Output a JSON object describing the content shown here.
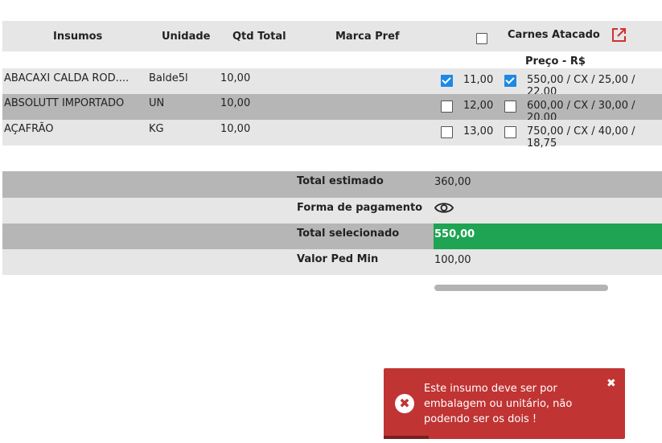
{
  "header": {
    "col_insumos": "Insumos",
    "col_unidade": "Unidade",
    "col_qtd_total": "Qtd Total",
    "col_marca_pref": "Marca Pref",
    "supplier_name": "Carnes Atacado",
    "price_label": "Preço - R$",
    "external_link_icon": "external-link-icon"
  },
  "rows": [
    {
      "insumo": "ABACAXI CALDA ROD....",
      "unidade": "Balde5l",
      "qtd": "10,00",
      "marca": "",
      "checked_qty": true,
      "qty_value": "11,00",
      "checked_price": true,
      "price_text": "550,00 / CX / 25,00 / 22,00"
    },
    {
      "insumo": "ABSOLUTT IMPORTADO",
      "unidade": "UN",
      "qtd": "10,00",
      "marca": "",
      "checked_qty": false,
      "qty_value": "12,00",
      "checked_price": false,
      "price_text": "600,00 / CX / 30,00 / 20,00"
    },
    {
      "insumo": "AÇAFRÃO",
      "unidade": "KG",
      "qtd": "10,00",
      "marca": "",
      "checked_qty": false,
      "qty_value": "13,00",
      "checked_price": false,
      "price_text": "750,00 / CX / 40,00 / 18,75"
    }
  ],
  "summary": {
    "total_estimado_label": "Total estimado",
    "total_estimado_value": "360,00",
    "forma_pagamento_label": "Forma de pagamento",
    "forma_pagamento_icon": "eye-icon",
    "total_selecionado_label": "Total selecionado",
    "total_selecionado_value": "550,00",
    "valor_ped_min_label": "Valor Ped Min",
    "valor_ped_min_value": "100,00"
  },
  "toast": {
    "message": "Este insumo deve ser por embalagem ou unitário, não podendo ser os dois !",
    "close_symbol": "✖",
    "icon": "error-icon"
  },
  "colors": {
    "accent_check": "#1e88e5",
    "success": "#1ea452",
    "error": "#c03433",
    "link_icon": "#d32f2f"
  }
}
